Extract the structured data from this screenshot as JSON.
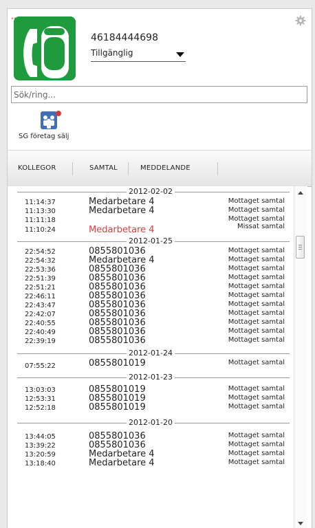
{
  "profile": {
    "quote_mark": "\"\"",
    "number": "46184444698",
    "status": "Tillgänglig",
    "avatar_color": "#1f9a3d"
  },
  "search": {
    "placeholder": "Sök/ring...",
    "value": ""
  },
  "group": {
    "label": "SG företag sälj",
    "icon": "group-icon",
    "badge_color": "#d23a3a"
  },
  "tabs": [
    {
      "label": "KOLLEGOR"
    },
    {
      "label": "SAMTAL"
    },
    {
      "label": "MEDDELANDE"
    }
  ],
  "call_log": [
    {
      "date": "2012-02-02",
      "entries": [
        {
          "time": "11:14:37",
          "name": "Medarbetare 4",
          "status": "Mottaget samtal",
          "missed": false
        },
        {
          "time": "11:13:30",
          "name": "Medarbetare 4",
          "status": "Mottaget samtal",
          "missed": false
        },
        {
          "time": "11:11:18",
          "name": "",
          "status": "Mottaget samtal",
          "missed": false
        },
        {
          "time": "11:10:24",
          "name": "Medarbetare 4",
          "status": "Missat samtal",
          "missed": true
        }
      ]
    },
    {
      "date": "2012-01-25",
      "entries": [
        {
          "time": "22:54:52",
          "name": "0855801036",
          "status": "Mottaget samtal",
          "missed": false
        },
        {
          "time": "22:54:32",
          "name": "Medarbetare 4",
          "status": "Mottaget samtal",
          "missed": false
        },
        {
          "time": "22:53:36",
          "name": "0855801036",
          "status": "Mottaget samtal",
          "missed": false
        },
        {
          "time": "22:51:39",
          "name": "0855801036",
          "status": "Mottaget samtal",
          "missed": false
        },
        {
          "time": "22:51:21",
          "name": "0855801036",
          "status": "Mottaget samtal",
          "missed": false
        },
        {
          "time": "22:46:11",
          "name": "0855801036",
          "status": "Mottaget samtal",
          "missed": false
        },
        {
          "time": "22:43:47",
          "name": "0855801036",
          "status": "Mottaget samtal",
          "missed": false
        },
        {
          "time": "22:42:07",
          "name": "0855801036",
          "status": "Mottaget samtal",
          "missed": false
        },
        {
          "time": "22:40:55",
          "name": "0855801036",
          "status": "Mottaget samtal",
          "missed": false
        },
        {
          "time": "22:40:49",
          "name": "0855801036",
          "status": "Mottaget samtal",
          "missed": false
        },
        {
          "time": "22:39:19",
          "name": "0855801036",
          "status": "Mottaget samtal",
          "missed": false
        }
      ]
    },
    {
      "date": "2012-01-24",
      "entries": [
        {
          "time": "07:55:22",
          "name": "0855801019",
          "status": "Mottaget samtal",
          "missed": false
        }
      ]
    },
    {
      "date": "2012-01-23",
      "entries": [
        {
          "time": "13:03:03",
          "name": "0855801019",
          "status": "Mottaget samtal",
          "missed": false
        },
        {
          "time": "12:53:31",
          "name": "0855801019",
          "status": "Mottaget samtal",
          "missed": false
        },
        {
          "time": "12:52:18",
          "name": "0855801019",
          "status": "Mottaget samtal",
          "missed": false
        }
      ]
    },
    {
      "date": "2012-01-20",
      "entries": [
        {
          "time": "13:44:05",
          "name": "0855801036",
          "status": "Mottaget samtal",
          "missed": false
        },
        {
          "time": "13:39:22",
          "name": "0855801036",
          "status": "Mottaget samtal",
          "missed": false
        },
        {
          "time": "13:20:59",
          "name": "Medarbetare 4",
          "status": "Mottaget samtal",
          "missed": false
        },
        {
          "time": "13:18:40",
          "name": "Medarbetare 4",
          "status": "Mottaget samtal",
          "missed": false
        }
      ]
    }
  ],
  "colors": {
    "missed": "#e23a3a",
    "gear": "#b5b5b5"
  }
}
